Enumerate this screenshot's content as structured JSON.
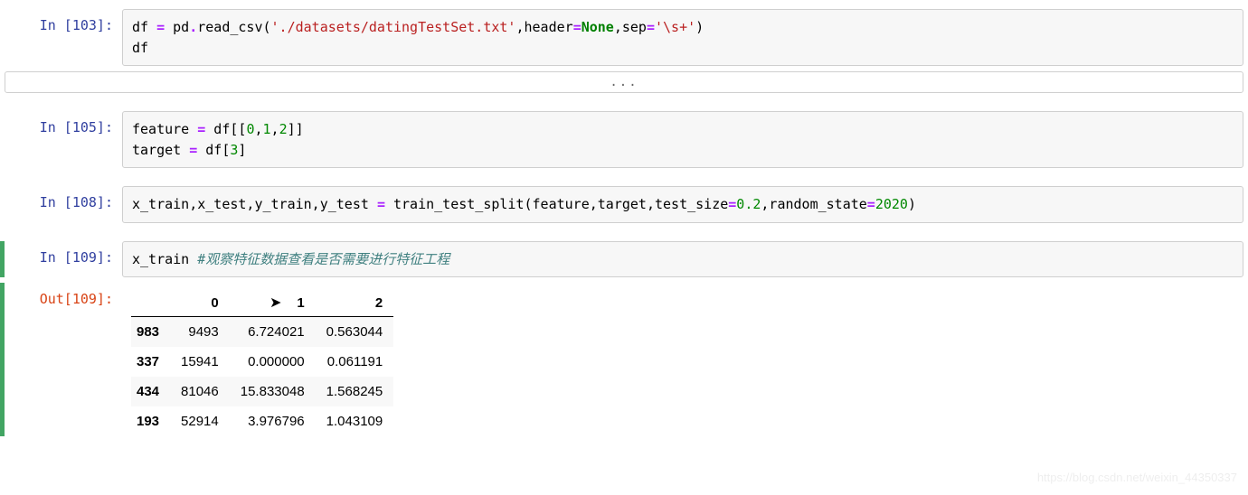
{
  "cells": {
    "c103": {
      "prompt": "In [103]:",
      "code": {
        "t1": "df ",
        "t2": "=",
        "t3": " pd",
        "t4": ".",
        "t5": "read_csv(",
        "t6": "'./datasets/datingTestSet.txt'",
        "t7": ",header",
        "t8": "=",
        "t9": "None",
        "t10": ",sep",
        "t11": "=",
        "t12": "'\\s+'",
        "t13": ")",
        "t14": "df"
      }
    },
    "collapsed": "...",
    "c105": {
      "prompt": "In [105]:",
      "code": {
        "t1": "feature ",
        "t2": "=",
        "t3": " df[[",
        "t4": "0",
        "t5": ",",
        "t6": "1",
        "t7": ",",
        "t8": "2",
        "t9": "]]",
        "t10": "target ",
        "t11": "=",
        "t12": " df[",
        "t13": "3",
        "t14": "]"
      }
    },
    "c108": {
      "prompt": "In [108]:",
      "code": {
        "t1": "x_train,x_test,y_train,y_test ",
        "t2": "=",
        "t3": " train_test_split(feature,target,test_size",
        "t4": "=",
        "t5": "0.2",
        "t6": ",random_state",
        "t7": "=",
        "t8": "2020",
        "t9": ")"
      }
    },
    "c109": {
      "prompt": "In [109]:",
      "code": {
        "t1": "x_train ",
        "t2": "#观察特征数据查看是否需要进行特征工程"
      },
      "outprompt": "Out[109]:"
    }
  },
  "chart_data": {
    "type": "table",
    "columns": [
      "0",
      "1",
      "2"
    ],
    "index": [
      "983",
      "337",
      "434",
      "193"
    ],
    "rows": [
      [
        "9493",
        "6.724021",
        "0.563044"
      ],
      [
        "15941",
        "0.000000",
        "0.061191"
      ],
      [
        "81046",
        "15.833048",
        "1.568245"
      ],
      [
        "52914",
        "3.976796",
        "1.043109"
      ]
    ]
  },
  "watermark": "https://blog.csdn.net/weixin_44350337"
}
